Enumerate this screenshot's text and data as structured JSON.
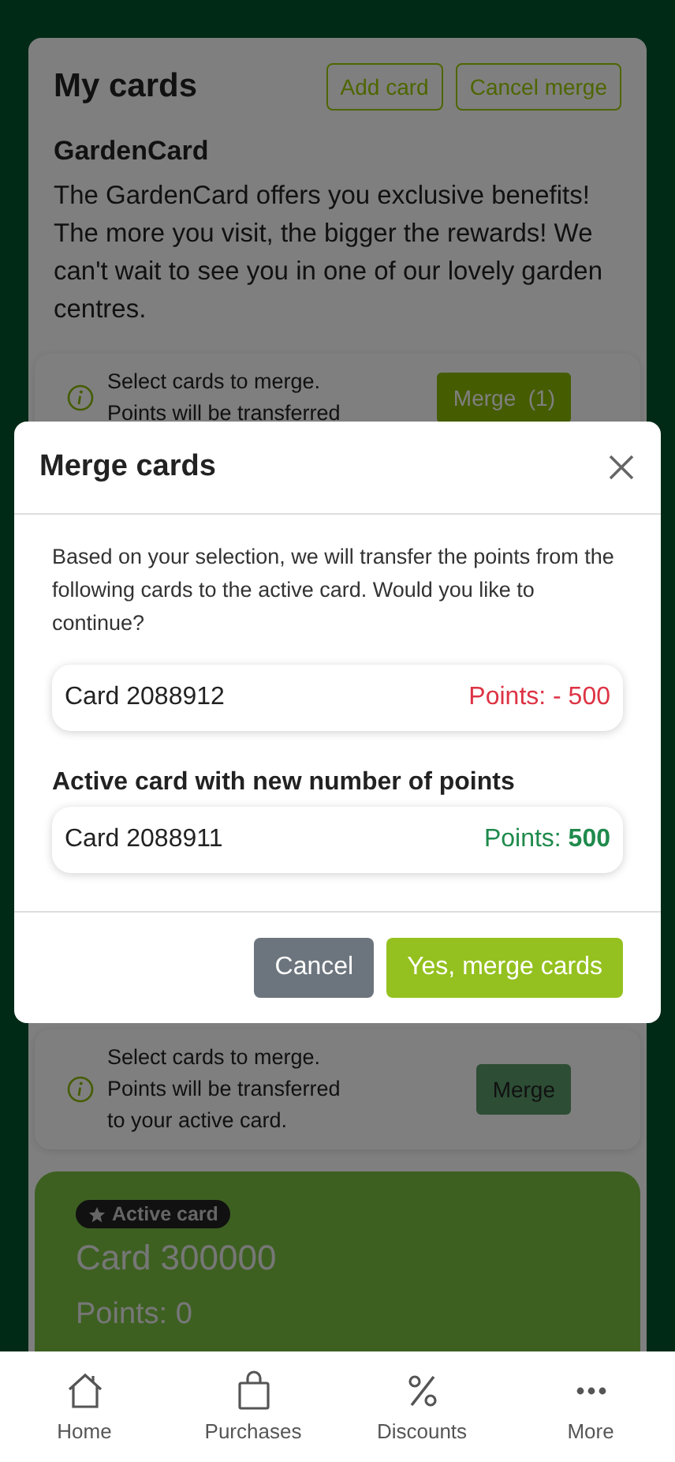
{
  "page": {
    "title": "My cards",
    "buttons": [
      {
        "label": "Add card"
      },
      {
        "label": "Cancel merge"
      }
    ],
    "program_title": "GardenCard",
    "description": "The GardenCard offers you exclusive benefits! The more you visit, the bigger the rewards! We can't wait to see you in one of our lovely garden centres.",
    "banners": [
      {
        "lines": [
          "Select cards to merge.",
          "Points will be transferred"
        ],
        "button": "Merge  (1)",
        "disabled": false
      },
      {
        "lines": [
          "Select cards to merge.",
          "Points will be transferred",
          "to your active card."
        ],
        "button": "Merge",
        "disabled": true
      }
    ],
    "active_card": {
      "badge": "Active card",
      "name": "Card 300000",
      "points": "Points: 0"
    }
  },
  "dialog": {
    "title": "Merge cards",
    "message": "Based on your selection, we will transfer the points from the following cards to the active card. Would you like to continue?",
    "source_cards": [
      {
        "name": "Card 2088912",
        "points": "Points: - 500"
      }
    ],
    "active_heading": "Active card with new number of points",
    "active_card": {
      "name": "Card 2088911",
      "points": "Points: **500**"
    },
    "buttons": [
      {
        "label": "Cancel",
        "kind": "secondary"
      },
      {
        "label": "Yes, merge cards",
        "kind": "primary"
      }
    ]
  },
  "nav": [
    {
      "label": "Home",
      "kind": "home"
    },
    {
      "label": "Purchases",
      "kind": "bag"
    },
    {
      "label": "Discounts",
      "kind": "percent"
    },
    {
      "label": "More",
      "kind": "more"
    }
  ]
}
